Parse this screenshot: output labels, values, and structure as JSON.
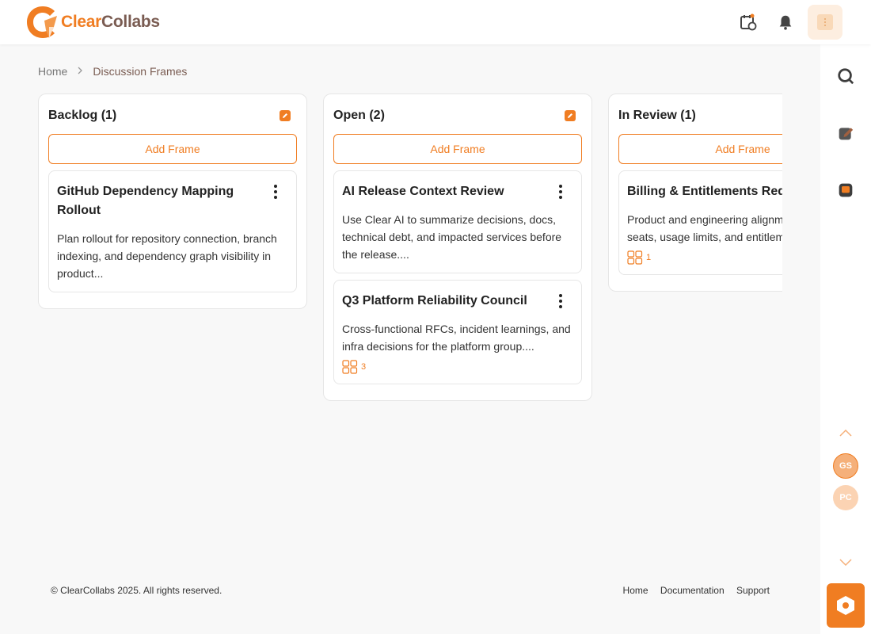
{
  "app": {
    "name_part1": "Clear",
    "name_part2": "Collabs"
  },
  "header": {
    "icons": [
      "calendar-refresh-icon",
      "bell-icon",
      "user-avatar-icon"
    ],
    "accent": "#f07d22"
  },
  "breadcrumb": {
    "home": "Home",
    "current": "Discussion Frames"
  },
  "columns": [
    {
      "title": "Backlog (1)",
      "add_label": "Add Frame",
      "cards": [
        {
          "title": "GitHub Dependency Mapping Rollout",
          "description": "Plan rollout for repository connection, branch indexing, and dependency graph visibility in product...",
          "count": ""
        }
      ]
    },
    {
      "title": "Open (2)",
      "add_label": "Add Frame",
      "cards": [
        {
          "title": "AI Release Context Review",
          "description": "Use Clear AI to summarize decisions, docs, technical debt, and impacted services before the release....",
          "count": ""
        },
        {
          "title": "Q3 Platform Reliability Council",
          "description": "Cross-functional RFCs, incident learnings, and infra decisions for the platform group....",
          "count": "3"
        }
      ]
    },
    {
      "title": "In Review (1)",
      "add_label": "Add Frame",
      "cards": [
        {
          "title": "Billing & Entitlements Redesign",
          "description": "Product and engineering alignment on plans, seats, usage limits, and entitlement change...",
          "count": "1"
        }
      ]
    }
  ],
  "rightbar": {
    "icons": [
      "search-icon",
      "edit-note-icon",
      "chat-icon",
      "chevron-up-icon",
      "chevron-down-icon",
      "hexagon-icon"
    ],
    "avatars": [
      {
        "initials": "GS",
        "color": "#f5b07a"
      },
      {
        "initials": "PC",
        "color": "#fbd3b3"
      }
    ]
  },
  "footer": {
    "copyright": "© ClearCollabs 2025. All rights reserved.",
    "links": [
      "Home",
      "Documentation",
      "Support"
    ]
  }
}
